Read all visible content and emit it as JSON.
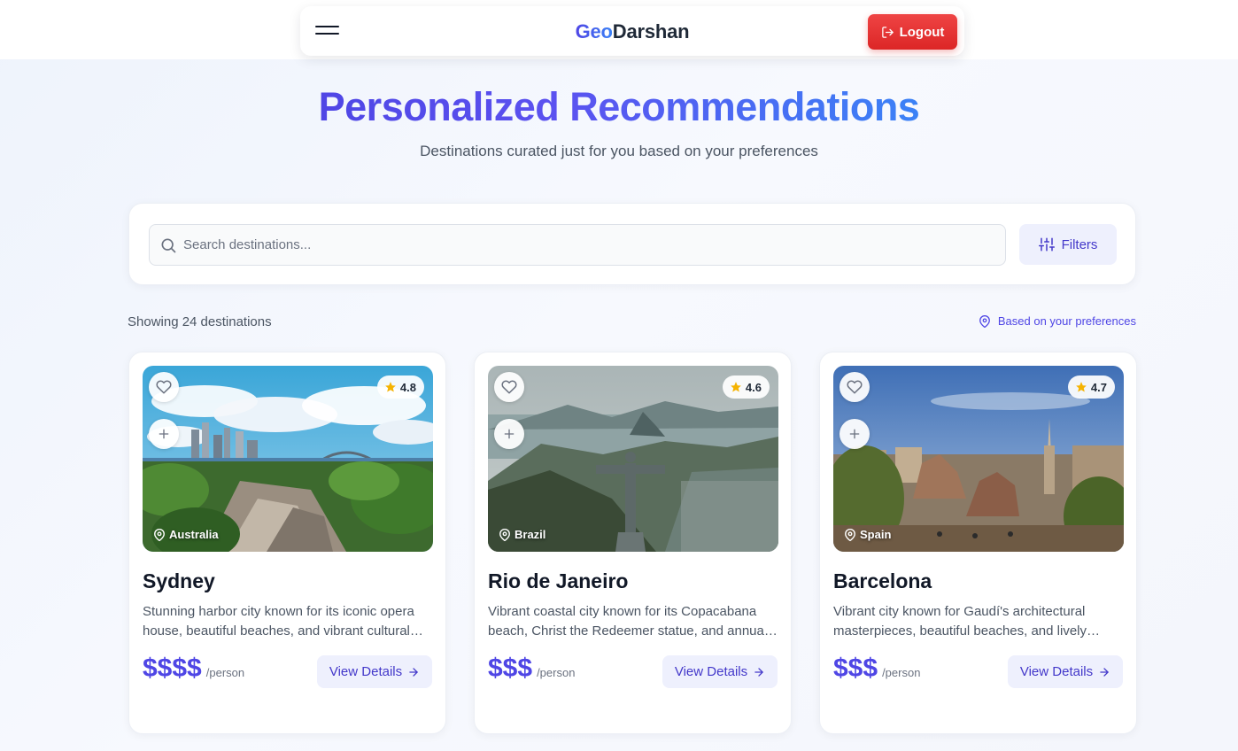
{
  "nav": {
    "brand_geo": "Geo",
    "brand_rest": "Darshan",
    "logout_label": "Logout"
  },
  "hero": {
    "title": "Personalized Recommendations",
    "subtitle": "Destinations curated just for you based on your preferences"
  },
  "search": {
    "placeholder": "Search destinations...",
    "value": "",
    "filters_label": "Filters"
  },
  "results": {
    "count_text": "Showing 24 destinations",
    "preferences_link": "Based on your preferences"
  },
  "colors": {
    "accent": "#4f46e5",
    "accent_light": "#eef0fd",
    "logout_red": "#dc2626",
    "star": "#f5b301"
  },
  "cards": [
    {
      "name": "Sydney",
      "country": "Australia",
      "rating": "4.8",
      "description": "Stunning harbor city known for its iconic opera house, beautiful beaches, and vibrant cultural scene.",
      "price": "$$$$",
      "price_unit": "/person",
      "cta": "View Details"
    },
    {
      "name": "Rio de Janeiro",
      "country": "Brazil",
      "rating": "4.6",
      "description": "Vibrant coastal city known for its Copacabana beach, Christ the Redeemer statue, and annual carnival.",
      "price": "$$$",
      "price_unit": "/person",
      "cta": "View Details"
    },
    {
      "name": "Barcelona",
      "country": "Spain",
      "rating": "4.7",
      "description": "Vibrant city known for Gaudí's architectural masterpieces, beautiful beaches, and lively nightlife.",
      "price": "$$$",
      "price_unit": "/person",
      "cta": "View Details"
    }
  ]
}
